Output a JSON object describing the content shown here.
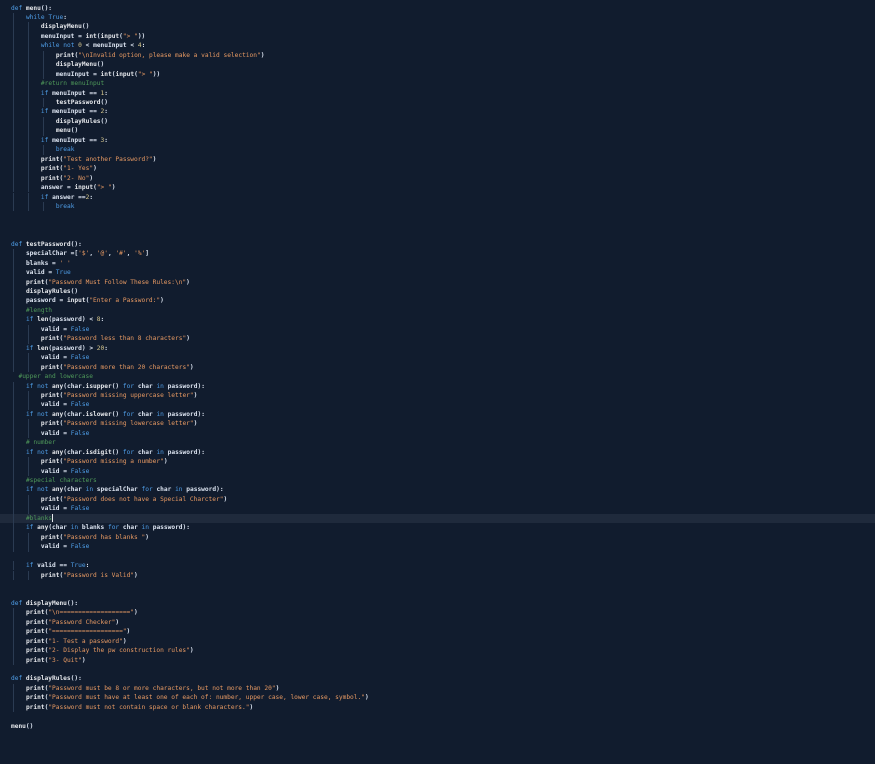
{
  "editor": {
    "lines": [
      {
        "text": "def menu():"
      },
      {
        "text": "    while True:"
      },
      {
        "text": "        displayMenu()"
      },
      {
        "text": "        menuInput = int(input(\"> \"))"
      },
      {
        "text": "        while not 0 < menuInput < 4:"
      },
      {
        "text": "            print(\"\\nInvalid option, please make a valid selection\")"
      },
      {
        "text": "            displayMenu()"
      },
      {
        "text": "            menuInput = int(input(\"> \"))"
      },
      {
        "text": "        #return menuInput"
      },
      {
        "text": "        if menuInput == 1:"
      },
      {
        "text": "            testPassword()"
      },
      {
        "text": "        if menuInput == 2:"
      },
      {
        "text": "            displayRules()"
      },
      {
        "text": "            menu()"
      },
      {
        "text": "        if menuInput == 3:"
      },
      {
        "text": "            break"
      },
      {
        "text": "        print(\"Test another Password?\")"
      },
      {
        "text": "        print(\"1- Yes\")"
      },
      {
        "text": "        print(\"2- No\")"
      },
      {
        "text": "        answer = input(\"> \")"
      },
      {
        "text": "        if answer ==2:"
      },
      {
        "text": "            break"
      },
      {
        "text": ""
      },
      {
        "text": ""
      },
      {
        "text": ""
      },
      {
        "text": "def testPassword():"
      },
      {
        "text": "    specialChar =['$', '@', '#', '%']"
      },
      {
        "text": "    blanks = ' '"
      },
      {
        "text": "    valid = True"
      },
      {
        "text": "    print(\"Password Must Follow These Rules:\\n\")"
      },
      {
        "text": "    displayRules()"
      },
      {
        "text": "    password = input(\"Enter a Password:\")"
      },
      {
        "text": "    #length"
      },
      {
        "text": "    if len(password) < 8:"
      },
      {
        "text": "        valid = False"
      },
      {
        "text": "        print(\"Password less than 8 characters\")"
      },
      {
        "text": "    if len(password) > 20:"
      },
      {
        "text": "        valid = False"
      },
      {
        "text": "        print(\"Password more than 20 characters\")"
      },
      {
        "text": "  #upper and lowercase"
      },
      {
        "text": "    if not any(char.isupper() for char in password):"
      },
      {
        "text": "        print(\"Password missing uppercase letter\")"
      },
      {
        "text": "        valid = False"
      },
      {
        "text": "    if not any(char.islower() for char in password):"
      },
      {
        "text": "        print(\"Password missing lowercase letter\")"
      },
      {
        "text": "        valid = False"
      },
      {
        "text": "    # number"
      },
      {
        "text": "    if not any(char.isdigit() for char in password):"
      },
      {
        "text": "        print(\"Password missing a number\")"
      },
      {
        "text": "        valid = False"
      },
      {
        "text": "    #special characters"
      },
      {
        "text": "    if not any(char in specialChar for char in password):"
      },
      {
        "text": "        print(\"Password does not have a Special Charcter\")"
      },
      {
        "text": "        valid = False"
      },
      {
        "text": "    #blanks",
        "current": true
      },
      {
        "text": "    if any(char in blanks for char in password):"
      },
      {
        "text": "        print(\"Password has blanks \")"
      },
      {
        "text": "        valid = False"
      },
      {
        "text": ""
      },
      {
        "text": "    if valid == True:"
      },
      {
        "text": "        print(\"Password is Valid\")"
      },
      {
        "text": ""
      },
      {
        "text": ""
      },
      {
        "text": "def displayMenu():"
      },
      {
        "text": "    print(\"\\n===================\")"
      },
      {
        "text": "    print(\"Password Checker\")"
      },
      {
        "text": "    print(\"===================\")"
      },
      {
        "text": "    print(\"1- Test a password\")"
      },
      {
        "text": "    print(\"2- Display the pw construction rules\")"
      },
      {
        "text": "    print(\"3- Quit\")"
      },
      {
        "text": ""
      },
      {
        "text": "def displayRules():"
      },
      {
        "text": "    print(\"Password must be 8 or more characters, but not more than 20\")"
      },
      {
        "text": "    print(\"Password must have at least one of each of: number, upper case, lower case, symbol.\")"
      },
      {
        "text": "    print(\"Password must not contain space or blank characters.\")"
      },
      {
        "text": ""
      },
      {
        "text": "menu()"
      }
    ]
  },
  "colors": {
    "background": "#111c2e",
    "keyword": "#4f9ee8",
    "string": "#e89a63",
    "comment": "#4f9a5a",
    "text": "#dbe3f0",
    "current_line": "#1f2a3c"
  }
}
